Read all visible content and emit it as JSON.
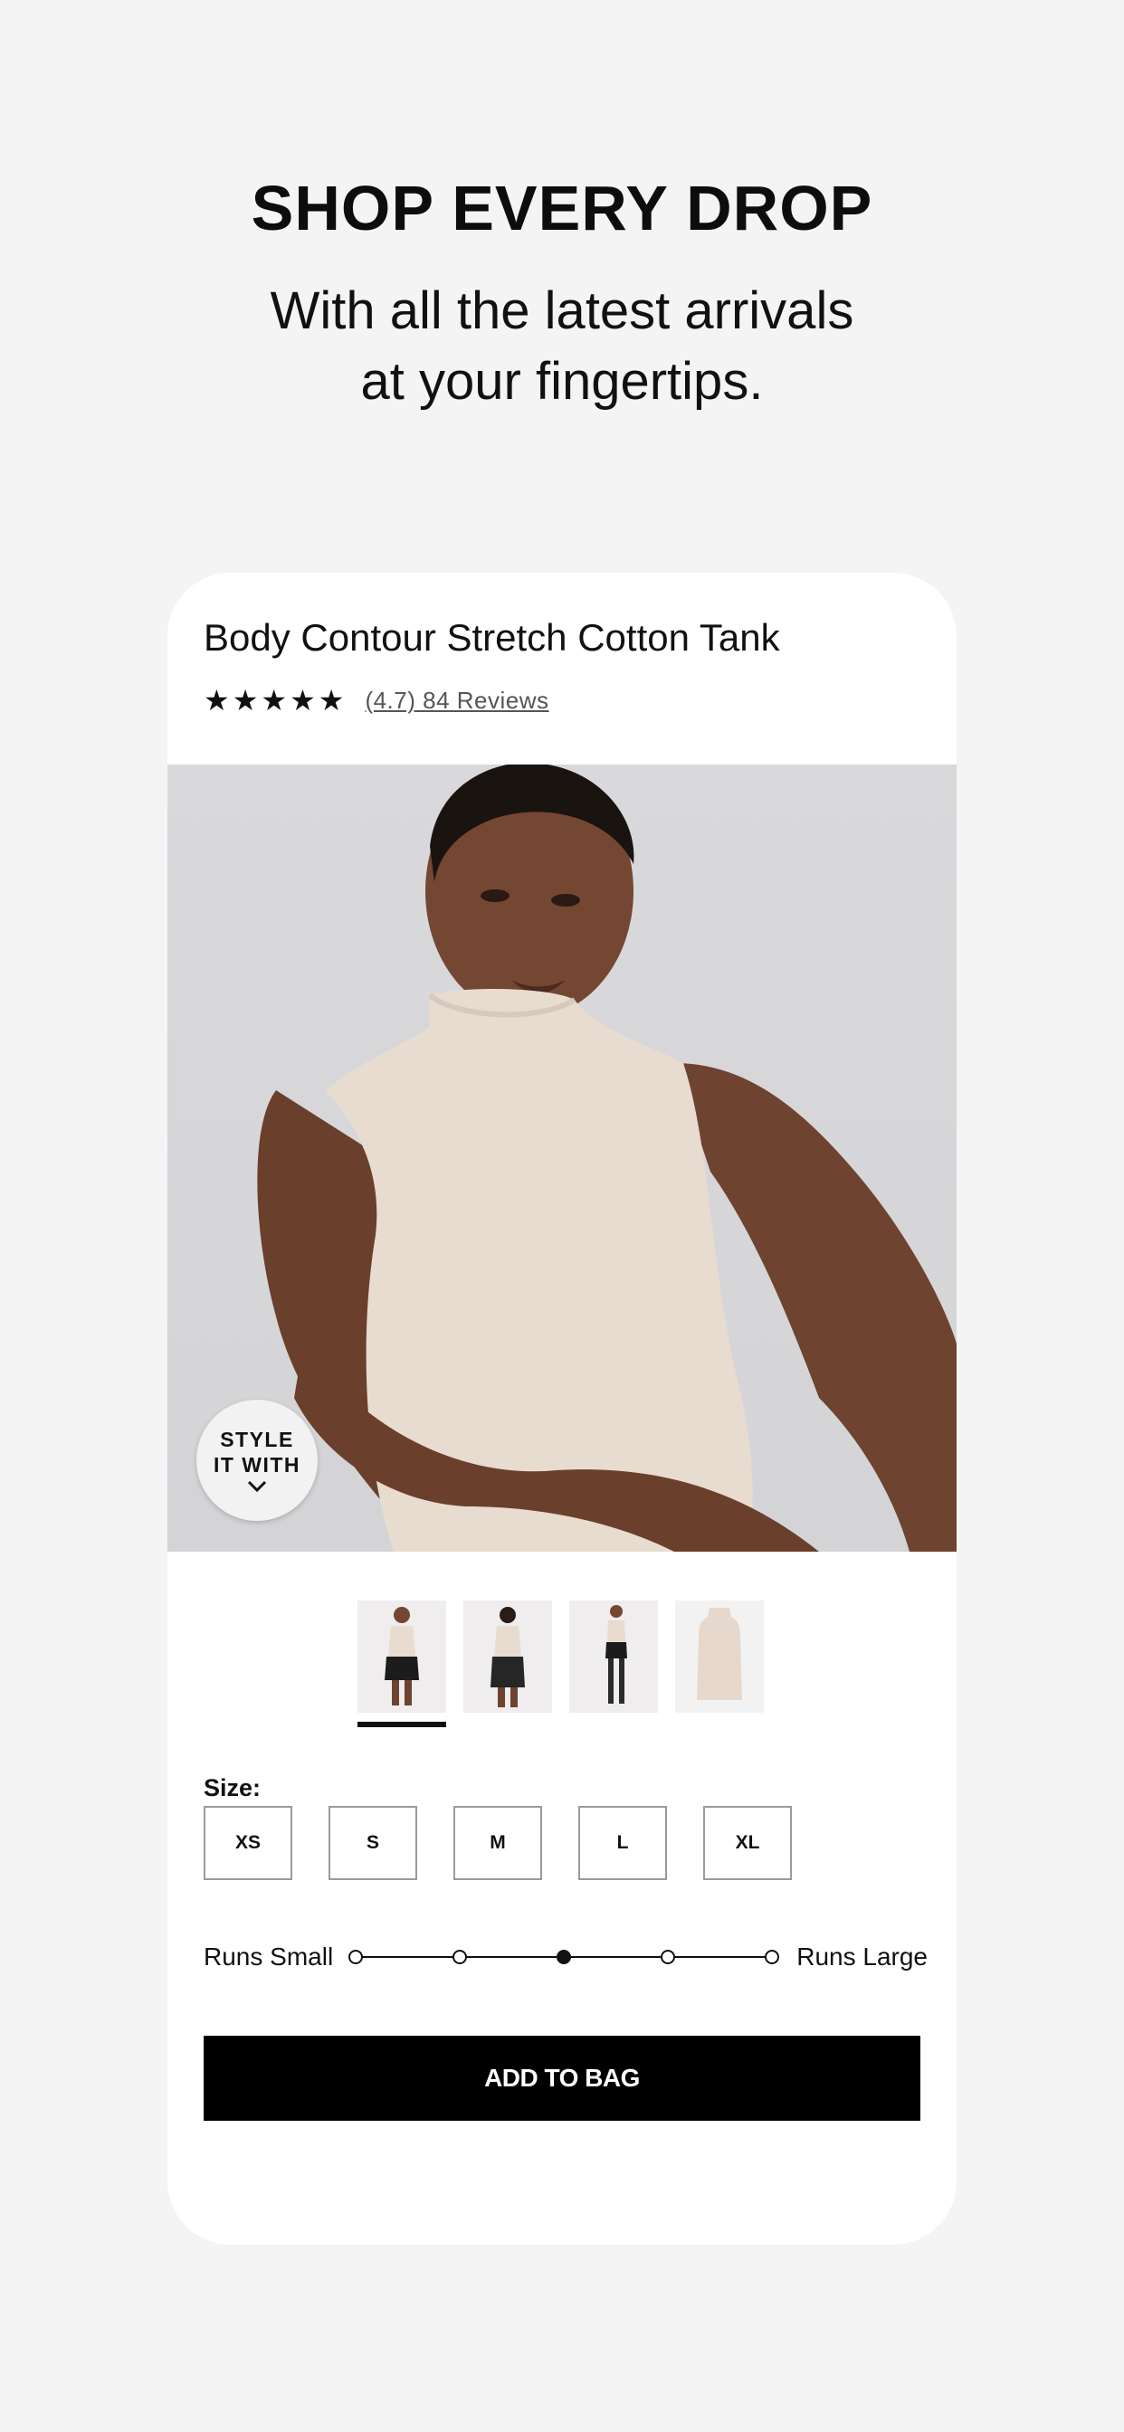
{
  "hero": {
    "title": "SHOP EVERY DROP",
    "subtitle_line1": "With all the latest arrivals",
    "subtitle_line2": "at your fingertips."
  },
  "product": {
    "title": "Body Contour Stretch Cotton Tank",
    "rating_stars": 5,
    "reviews_text": "(4.7) 84 Reviews",
    "style_button": {
      "line1": "STYLE",
      "line2": "IT WITH",
      "icon": "chevron-down-icon"
    },
    "thumbnails": [
      {
        "label": "front view"
      },
      {
        "label": "back view"
      },
      {
        "label": "full length"
      },
      {
        "label": "flat lay"
      }
    ],
    "selected_thumbnail_index": 0,
    "size_label": "Size:",
    "sizes": [
      "XS",
      "S",
      "M",
      "L",
      "XL"
    ],
    "fit": {
      "left_label": "Runs Small",
      "right_label": "Runs Large",
      "selected_index": 2,
      "steps": 5
    },
    "add_to_bag_label": "ADD TO BAG"
  },
  "colors": {
    "background": "#f4f4f4",
    "card": "#ffffff",
    "primary": "#000000",
    "tank": "#e8dbd0",
    "skin": "#6e4330"
  }
}
